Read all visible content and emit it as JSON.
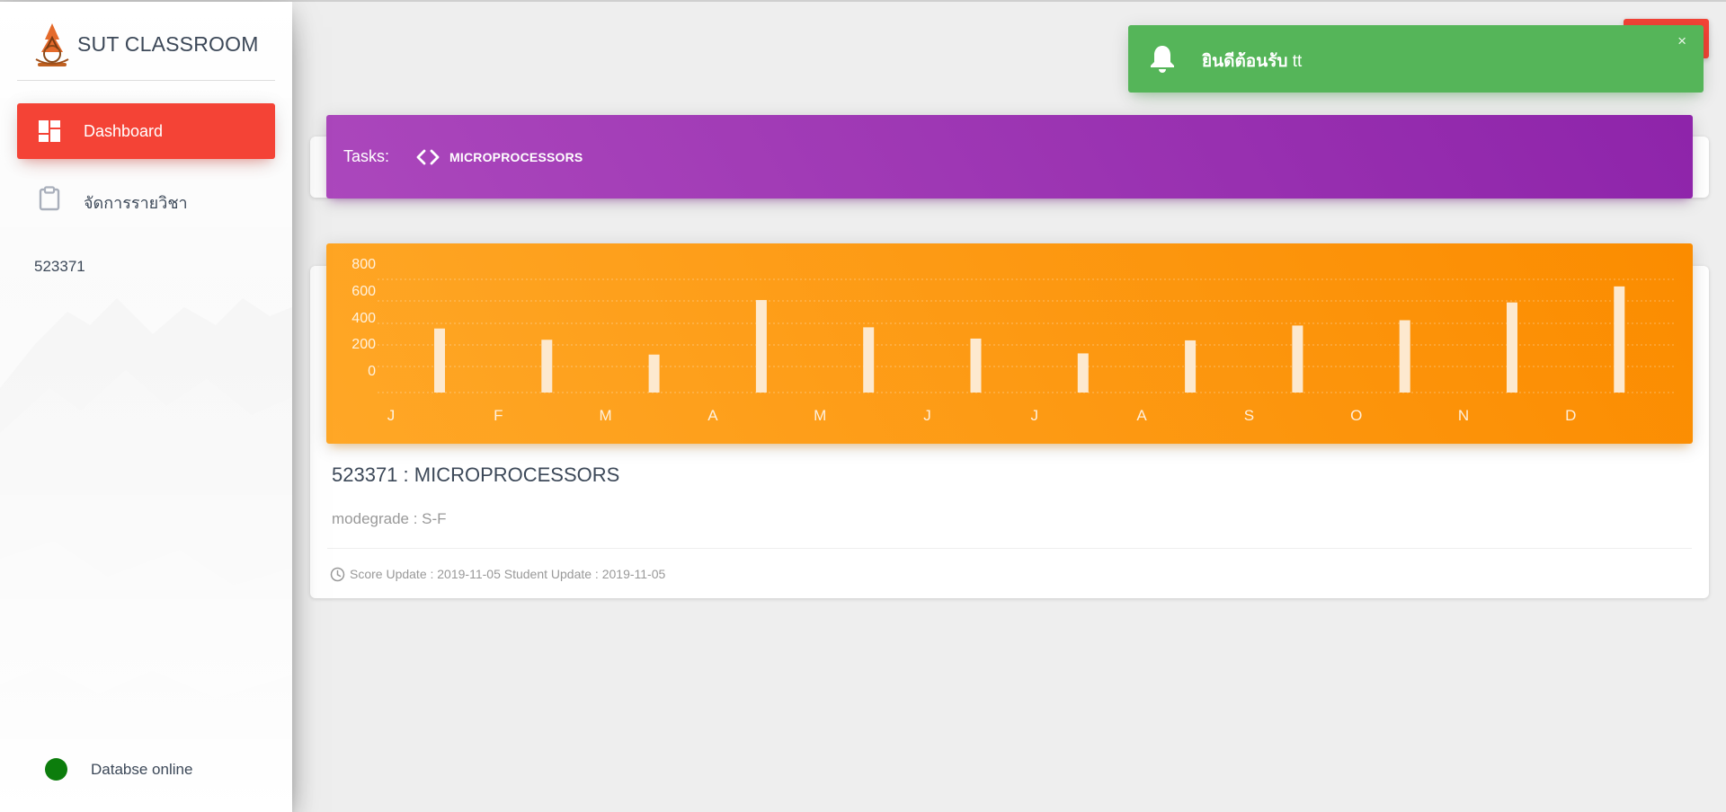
{
  "app": {
    "brand": "SUT CLASSROOM",
    "logo_icon": "university-emblem"
  },
  "sidebar": {
    "items": [
      {
        "label": "Dashboard",
        "icon": "dashboard-icon",
        "active": true
      },
      {
        "label": "จัดการรายวิชา",
        "icon": "clipboard-icon",
        "active": false
      }
    ],
    "course_code": "523371",
    "db_status": {
      "label": "Databse online",
      "color": "#0c7d0c"
    }
  },
  "notification": {
    "title": "ยินดีต้อนรับ",
    "user": "tt",
    "close": "×",
    "icon": "bell-icon",
    "color": "#55b559"
  },
  "tasks": {
    "label": "Tasks:",
    "tabs": [
      {
        "label": "MICROPROCESSORS",
        "icon": "code-icon"
      }
    ]
  },
  "chart_data": {
    "type": "bar",
    "categories": [
      "J",
      "F",
      "M",
      "A",
      "M",
      "J",
      "J",
      "A",
      "S",
      "O",
      "N",
      "D"
    ],
    "values": [
      540,
      445,
      320,
      780,
      550,
      455,
      330,
      440,
      565,
      610,
      760,
      895
    ],
    "y_ticks": [
      "800",
      "600",
      "400",
      "200",
      "0"
    ],
    "grid": true,
    "bar_color": "#fde9cf"
  },
  "course": {
    "title": "523371 : MICROPROCESSORS",
    "modegrade": "modegrade : S-F",
    "footer": "Score Update : 2019-11-05 Student Update : 2019-11-05",
    "footer_icon": "clock-icon"
  }
}
